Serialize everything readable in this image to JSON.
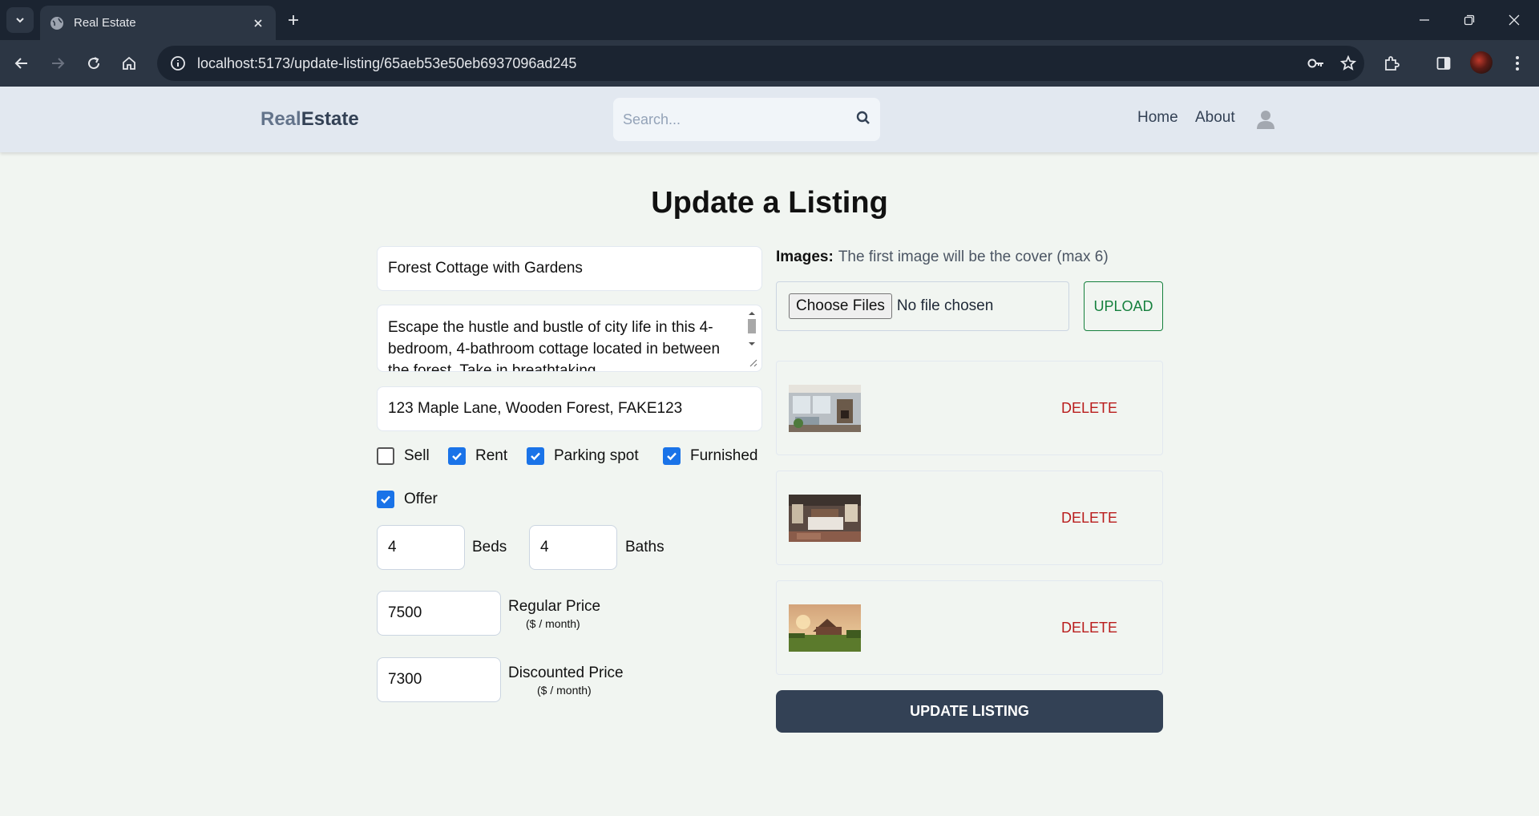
{
  "browser": {
    "tab_title": "Real Estate",
    "url": "localhost:5173/update-listing/65aeb53e50eb6937096ad245"
  },
  "site": {
    "logo_part1": "Real",
    "logo_part2": "Estate",
    "search_placeholder": "Search...",
    "nav": {
      "home": "Home",
      "about": "About"
    }
  },
  "page": {
    "title": "Update a Listing"
  },
  "form": {
    "name": "Forest Cottage with Gardens",
    "description": "Escape the hustle and bustle of city life in this 4-bedroom, 4-bathroom cottage located in between the forest. Take in breathtaking",
    "address": "123 Maple Lane, Wooden Forest, FAKE123",
    "checkboxes": {
      "sell": {
        "label": "Sell",
        "checked": false
      },
      "rent": {
        "label": "Rent",
        "checked": true
      },
      "parking": {
        "label": "Parking spot",
        "checked": true
      },
      "furnished": {
        "label": "Furnished",
        "checked": true
      },
      "offer": {
        "label": "Offer",
        "checked": true
      }
    },
    "beds": "4",
    "beds_label": "Beds",
    "baths": "4",
    "baths_label": "Baths",
    "regular_price": "7500",
    "regular_price_label": "Regular Price",
    "regular_price_unit": "($ / month)",
    "discounted_price": "7300",
    "discounted_price_label": "Discounted Price",
    "discounted_price_unit": "($ / month)"
  },
  "images": {
    "label": "Images:",
    "hint": "The first image will be the cover (max 6)",
    "choose_files": "Choose Files",
    "no_file": "No file chosen",
    "upload": "UPLOAD",
    "delete_label": "DELETE",
    "items": [
      {
        "delete": "DELETE"
      },
      {
        "delete": "DELETE"
      },
      {
        "delete": "DELETE"
      }
    ]
  },
  "submit": "UPDATE LISTING",
  "colors": {
    "accent_blue": "#1a73e8",
    "primary_dark": "#334155",
    "upload_green": "#15803d",
    "delete_red": "#b91c1c"
  }
}
